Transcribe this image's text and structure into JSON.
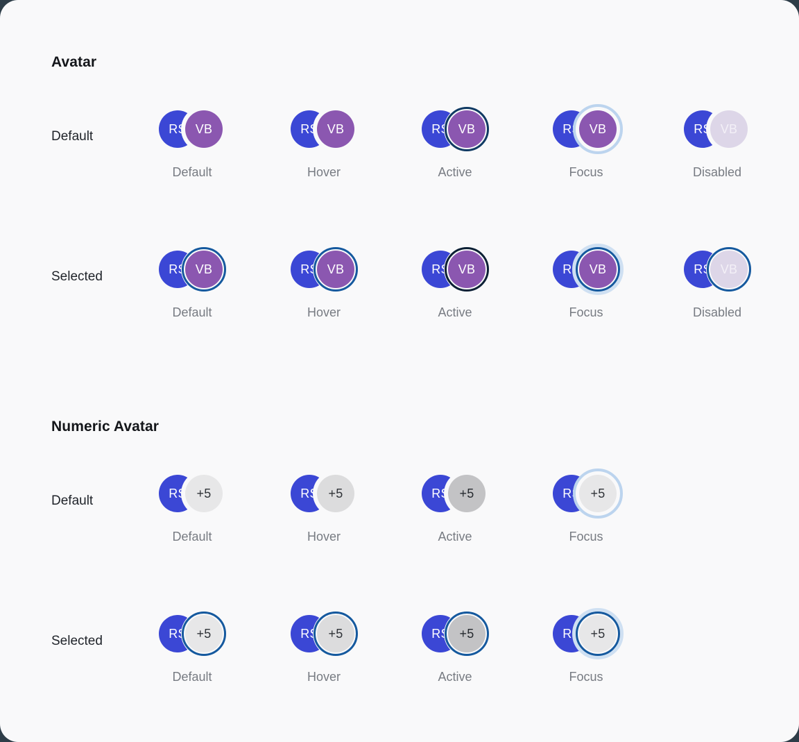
{
  "canvas": {
    "background": "#f9f9fa",
    "corner_radius": "26px"
  },
  "colors": {
    "avatar_blue": "#3b47d5",
    "avatar_purple": "#8b57b0",
    "avatar_purple_disabled": "#ddd6e8",
    "numeric_gray": "#e7e7e8",
    "numeric_gray_hover": "#dcdcdd",
    "numeric_gray_active": "#c3c3c5",
    "ring_selected": "#15599e",
    "ring_active": "#103a63",
    "ring_selected_active": "#0c2035",
    "ring_focus_halo": "#bcd4ee",
    "heading_text": "#14161a",
    "row_label_text": "#1f2329",
    "caption_text": "#777b82"
  },
  "sections": [
    {
      "title": "Avatar",
      "rows": [
        {
          "label": "Default",
          "cells": [
            {
              "caption": "Default",
              "lead": "RS",
              "second": "VB"
            },
            {
              "caption": "Hover",
              "lead": "RS",
              "second": "VB"
            },
            {
              "caption": "Active",
              "lead": "RS",
              "second": "VB"
            },
            {
              "caption": "Focus",
              "lead": "RS",
              "second": "VB"
            },
            {
              "caption": "Disabled",
              "lead": "RS",
              "second": "VB"
            }
          ]
        },
        {
          "label": "Selected",
          "cells": [
            {
              "caption": "Default",
              "lead": "RS",
              "second": "VB"
            },
            {
              "caption": "Hover",
              "lead": "RS",
              "second": "VB"
            },
            {
              "caption": "Active",
              "lead": "RS",
              "second": "VB"
            },
            {
              "caption": "Focus",
              "lead": "RS",
              "second": "VB"
            },
            {
              "caption": "Disabled",
              "lead": "RS",
              "second": "VB"
            }
          ]
        }
      ]
    },
    {
      "title": "Numeric Avatar",
      "rows": [
        {
          "label": "Default",
          "cells": [
            {
              "caption": "Default",
              "lead": "RS",
              "second": "+5"
            },
            {
              "caption": "Hover",
              "lead": "RS",
              "second": "+5"
            },
            {
              "caption": "Active",
              "lead": "RS",
              "second": "+5"
            },
            {
              "caption": "Focus",
              "lead": "RS",
              "second": "+5"
            }
          ]
        },
        {
          "label": "Selected",
          "cells": [
            {
              "caption": "Default",
              "lead": "RS",
              "second": "+5"
            },
            {
              "caption": "Hover",
              "lead": "RS",
              "second": "+5"
            },
            {
              "caption": "Active",
              "lead": "RS",
              "second": "+5"
            },
            {
              "caption": "Focus",
              "lead": "RS",
              "second": "+5"
            }
          ]
        }
      ]
    }
  ]
}
